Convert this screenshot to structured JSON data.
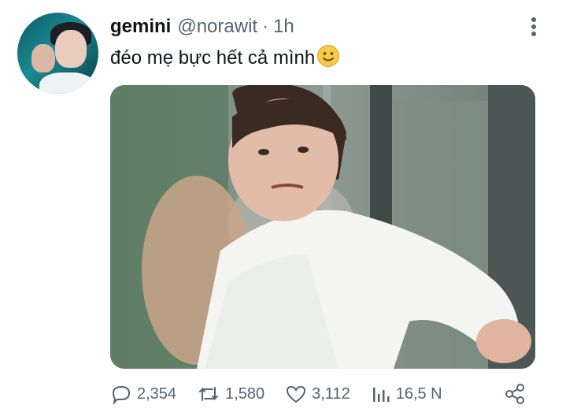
{
  "author": {
    "display_name": "gemini",
    "handle": "@norawit",
    "separator": "·",
    "timestamp": "1h"
  },
  "tweet": {
    "text": "đéo mẹ bực hết cả mình",
    "emoji": "slightly-smiling-face"
  },
  "media": {
    "type": "photo",
    "description_icon": "photo"
  },
  "actions": {
    "replies": "2,354",
    "retweets": "1,580",
    "likes": "3,112",
    "views": "16,5 N"
  },
  "colors": {
    "text_primary": "#0f1419",
    "text_secondary": "#536471",
    "emoji_yellow": "#f7c948"
  }
}
